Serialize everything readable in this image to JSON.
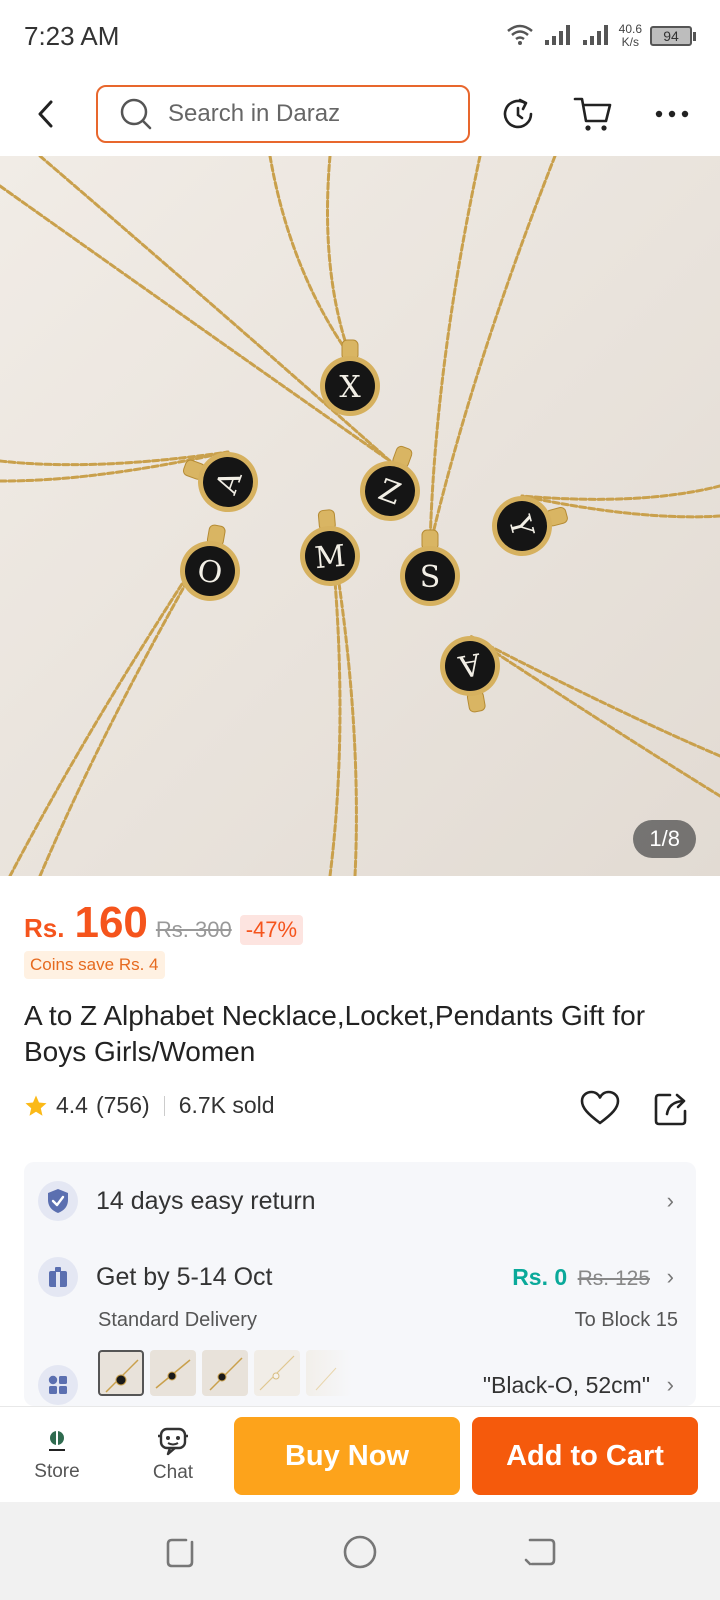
{
  "status_bar": {
    "time": "7:23 AM",
    "net_speed_value": "40.6",
    "net_speed_unit": "K/s",
    "battery": "94"
  },
  "top_bar": {
    "search_placeholder": "Search in Daraz"
  },
  "gallery": {
    "counter": "1/8",
    "pendant_letters": [
      "X",
      "Z",
      "A",
      "Y",
      "O",
      "M",
      "S",
      "A"
    ]
  },
  "product": {
    "currency": "Rs.",
    "price": "160",
    "old_price": "Rs. 300",
    "discount": "-47%",
    "coins": "Coins save Rs. 4",
    "title": "A to Z Alphabet Necklace,Locket,Pendants Gift for Boys Girls/Women",
    "rating": "4.4",
    "rating_count": "(756)",
    "sold": "6.7K sold"
  },
  "info": {
    "return_label": "14 days easy return",
    "delivery_label": "Get by 5-14 Oct",
    "delivery_sub": "Standard Delivery",
    "delivery_fee": "Rs. 0",
    "delivery_fee_old": "Rs. 125",
    "delivery_location": "To Block 15",
    "variant_selected": "\"Black-O, 52cm\""
  },
  "bottom_bar": {
    "store_label": "Store",
    "chat_label": "Chat",
    "buy_now": "Buy Now",
    "add_to_cart": "Add to Cart"
  },
  "colors": {
    "accent_orange": "#f5541c",
    "buy_now": "#fda31b",
    "add_to_cart": "#f55a0c",
    "free_delivery_green": "#0aa99a"
  }
}
